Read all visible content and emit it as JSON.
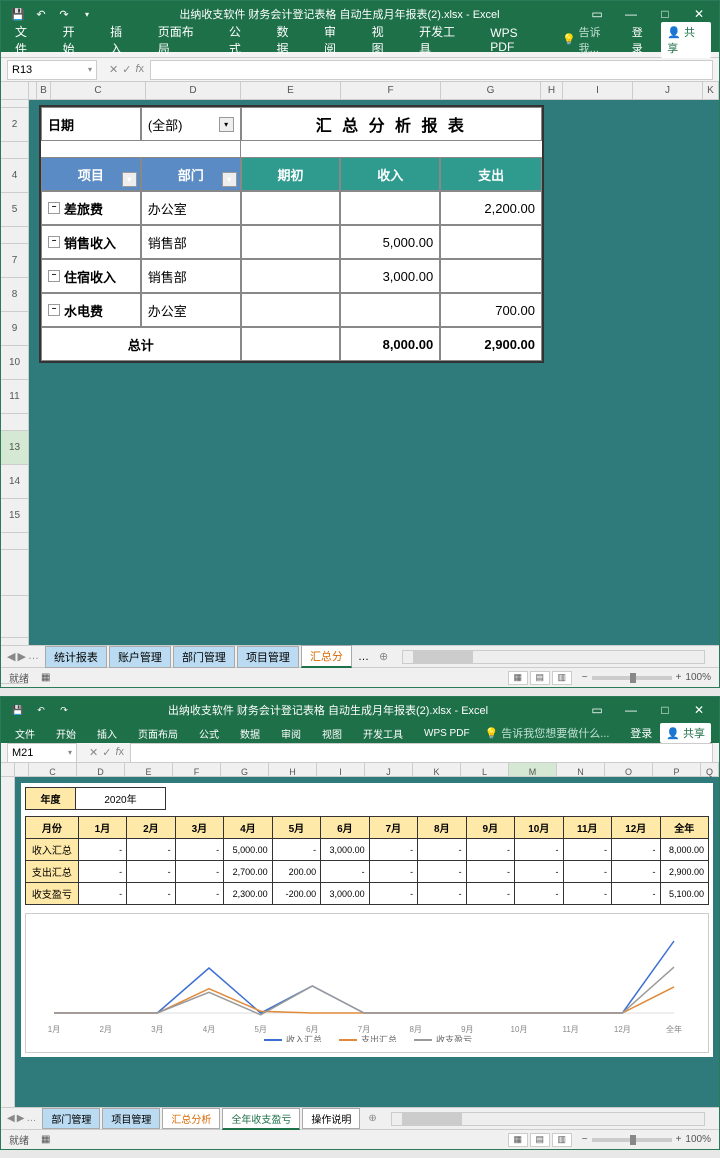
{
  "win1": {
    "title": "出纳收支软件 财务会计登记表格 自动生成月年报表(2).xlsx - Excel",
    "ribbon": [
      "文件",
      "开始",
      "插入",
      "页面布局",
      "公式",
      "数据",
      "审阅",
      "视图",
      "开发工具",
      "WPS PDF"
    ],
    "tell": "告诉我...",
    "login": "登录",
    "share": "共享",
    "namebox": "R13",
    "report": {
      "date_lbl": "日期",
      "date_val": "(全部)",
      "title": "汇 总 分 析 报 表",
      "cols": [
        "项目",
        "部门",
        "期初",
        "收入",
        "支出"
      ],
      "rows": [
        {
          "proj": "差旅费",
          "dept": "办公室",
          "qc": "",
          "sr": "",
          "zc": "2,200.00"
        },
        {
          "proj": "销售收入",
          "dept": "销售部",
          "qc": "",
          "sr": "5,000.00",
          "zc": ""
        },
        {
          "proj": "住宿收入",
          "dept": "销售部",
          "qc": "",
          "sr": "3,000.00",
          "zc": ""
        },
        {
          "proj": "水电费",
          "dept": "办公室",
          "qc": "",
          "sr": "",
          "zc": "700.00"
        }
      ],
      "total_lbl": "总计",
      "total_sr": "8,000.00",
      "total_zc": "2,900.00"
    },
    "tabs": [
      "统计报表",
      "账户管理",
      "部门管理",
      "项目管理",
      "汇总分"
    ],
    "status": "就绪",
    "zoom": "100%"
  },
  "win2": {
    "title": "出纳收支软件 财务会计登记表格 自动生成月年报表(2).xlsx - Excel",
    "ribbon": [
      "文件",
      "开始",
      "插入",
      "页面布局",
      "公式",
      "数据",
      "审阅",
      "视图",
      "开发工具",
      "WPS PDF"
    ],
    "tell": "告诉我您想要做什么...",
    "login": "登录",
    "share": "共享",
    "namebox": "M21",
    "year_lbl": "年度",
    "year_val": "2020年",
    "months_lbl": "月份",
    "months": [
      "1月",
      "2月",
      "3月",
      "4月",
      "5月",
      "6月",
      "7月",
      "8月",
      "9月",
      "10月",
      "11月",
      "12月",
      "全年"
    ],
    "rows": [
      {
        "lbl": "收入汇总",
        "v": [
          "-",
          "-",
          "-",
          "5,000.00",
          "-",
          "3,000.00",
          "-",
          "-",
          "-",
          "-",
          "-",
          "-",
          "8,000.00"
        ]
      },
      {
        "lbl": "支出汇总",
        "v": [
          "-",
          "-",
          "-",
          "2,700.00",
          "200.00",
          "-",
          "-",
          "-",
          "-",
          "-",
          "-",
          "-",
          "2,900.00"
        ]
      },
      {
        "lbl": "收支盈亏",
        "v": [
          "-",
          "-",
          "-",
          "2,300.00",
          "-200.00",
          "3,000.00",
          "-",
          "-",
          "-",
          "-",
          "-",
          "-",
          "5,100.00"
        ]
      }
    ],
    "legend": [
      "收入汇总",
      "支出汇总",
      "收支盈亏"
    ],
    "tabs": [
      "部门管理",
      "项目管理",
      "汇总分析",
      "全年收支盈亏",
      "操作说明"
    ],
    "status": "就绪",
    "zoom": "100%"
  },
  "chart_data": {
    "type": "line",
    "categories": [
      "1月",
      "2月",
      "3月",
      "4月",
      "5月",
      "6月",
      "7月",
      "8月",
      "9月",
      "10月",
      "11月",
      "12月",
      "全年"
    ],
    "series": [
      {
        "name": "收入汇总",
        "color": "#3b6fd1",
        "values": [
          0,
          0,
          0,
          5000,
          0,
          3000,
          0,
          0,
          0,
          0,
          0,
          0,
          8000
        ]
      },
      {
        "name": "支出汇总",
        "color": "#e08a3a",
        "values": [
          0,
          0,
          0,
          2700,
          200,
          0,
          0,
          0,
          0,
          0,
          0,
          0,
          2900
        ]
      },
      {
        "name": "收支盈亏",
        "color": "#9a9a9a",
        "values": [
          0,
          0,
          0,
          2300,
          -200,
          3000,
          0,
          0,
          0,
          0,
          0,
          0,
          5100
        ]
      }
    ],
    "ylim": [
      -1000,
      9000
    ]
  }
}
